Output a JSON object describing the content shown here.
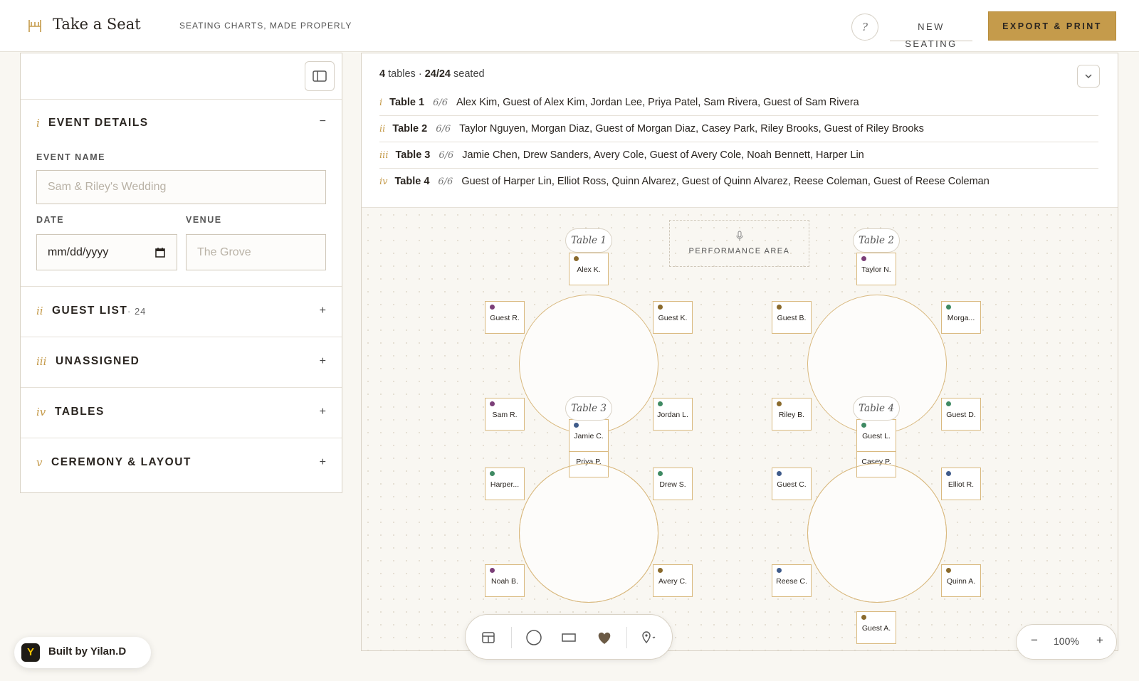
{
  "header": {
    "logo_text": "Take a Seat",
    "tagline": "SEATING CHARTS, MADE PROPERLY",
    "help_label": "?",
    "new_seating_label": "NEW SEATING",
    "export_label": "EXPORT & PRINT"
  },
  "sidebar": {
    "event_details": {
      "roman": "i",
      "title": "EVENT DETAILS",
      "toggle": "−",
      "event_name_label": "EVENT NAME",
      "event_name_placeholder": "Sam & Riley's Wedding",
      "date_label": "DATE",
      "date_placeholder": "mm/dd/yyyy",
      "venue_label": "VENUE",
      "venue_placeholder": "The Grove"
    },
    "guest_list": {
      "roman": "ii",
      "title": "GUEST LIST",
      "count": "· 24",
      "toggle": "+"
    },
    "unassigned": {
      "roman": "iii",
      "title": "UNASSIGNED",
      "toggle": "+"
    },
    "tables": {
      "roman": "iv",
      "title": "TABLES",
      "toggle": "+"
    },
    "ceremony": {
      "roman": "v",
      "title": "CEREMONY & LAYOUT",
      "toggle": "+"
    }
  },
  "summary": {
    "tables_count": "4",
    "tables_word": "tables ·",
    "seated": "24/24",
    "seated_word": "seated",
    "rows": [
      {
        "roman": "i",
        "name": "Table 1",
        "count": "6/6",
        "guests": "Alex Kim, Guest of Alex Kim, Jordan Lee, Priya Patel, Sam Rivera, Guest of Sam Rivera"
      },
      {
        "roman": "ii",
        "name": "Table 2",
        "count": "6/6",
        "guests": "Taylor Nguyen, Morgan Diaz, Guest of Morgan Diaz, Casey Park, Riley Brooks, Guest of Riley Brooks"
      },
      {
        "roman": "iii",
        "name": "Table 3",
        "count": "6/6",
        "guests": "Jamie Chen, Drew Sanders, Avery Cole, Guest of Avery Cole, Noah Bennett, Harper Lin"
      },
      {
        "roman": "iv",
        "name": "Table 4",
        "count": "6/6",
        "guests": "Guest of Harper Lin, Elliot Ross, Quinn Alvarez, Guest of Quinn Alvarez, Reese Coleman, Guest of Reese Coleman"
      }
    ]
  },
  "canvas": {
    "performance_area": "PERFORMANCE AREA",
    "table_tags": [
      "Table 1",
      "Table 2",
      "Table 3",
      "Table 4"
    ],
    "seats": {
      "t1_top": "Alex K.",
      "t1_tl": "Guest R.",
      "t1_tr": "Guest K.",
      "t1_bl": "Sam R.",
      "t1_br": "Jordan L.",
      "t2_top": "Taylor N.",
      "t2_tl": "Guest B.",
      "t2_tr": "Morga...",
      "t2_bl": "Riley B.",
      "t2_br": "Guest D.",
      "t3_top": "Jamie C.",
      "t3_top2": "Priya P.",
      "t3_tl": "Harper...",
      "t3_tr": "Drew S.",
      "t3_bl": "Noah B.",
      "t3_br": "Avery C.",
      "t4_top": "Guest L.",
      "t4_top2": "Casey P.",
      "t4_tl": "Guest C.",
      "t4_tr": "Elliot R.",
      "t4_bl": "Reese C.",
      "t4_br": "Quinn A.",
      "t4_bottom": "Guest A."
    }
  },
  "zoom": {
    "minus": "−",
    "level": "100%",
    "plus": "+"
  },
  "built_by": {
    "badge": "Y",
    "label": "Built by Yilan.D"
  },
  "colors": {
    "accent": "#c59b4b",
    "table_border": "#d9b97f",
    "dot_brown": "#8a6a2c",
    "dot_green": "#3f8a63",
    "dot_purple": "#7b3f78",
    "dot_blue": "#3f5b8a"
  }
}
